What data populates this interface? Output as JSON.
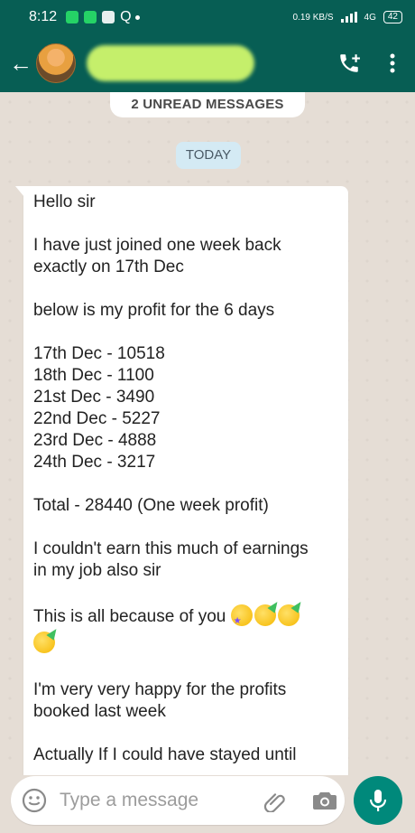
{
  "status_bar": {
    "time": "8:12",
    "speed_value": "0.19",
    "speed_unit": "KB/S",
    "network": "4G",
    "battery": "42"
  },
  "header": {
    "back_icon": "back-arrow-icon",
    "call_icon": "add-call-icon",
    "menu_icon": "more-vert-icon",
    "color": "#075e54"
  },
  "chat": {
    "unread_banner": "2 UNREAD MESSAGES",
    "date_chip": "TODAY",
    "message": {
      "greeting": "Hello sir",
      "intro": "I have just joined one week back\nexactly on 17th Dec",
      "profit_heading": "below is my profit for the 6 days",
      "profits": [
        "17th Dec - 10518",
        "18th Dec - 1100",
        "21st Dec -  3490",
        "22nd Dec - 5227",
        "23rd Dec - 4888",
        "24th Dec - 3217"
      ],
      "total": "Total - 28440 (One week profit)",
      "earnings": "I couldn't earn this much of earnings\nin my job also sir",
      "because": "This is all because of you",
      "happy": "I'm very very happy for the profits\nbooked last week",
      "actually": "Actually If I could have stayed until"
    }
  },
  "input": {
    "placeholder": "Type a message",
    "emoji_icon": "emoji-icon",
    "attach_icon": "paperclip-icon",
    "camera_icon": "camera-icon",
    "mic_icon": "mic-icon",
    "accent": "#00897b"
  }
}
